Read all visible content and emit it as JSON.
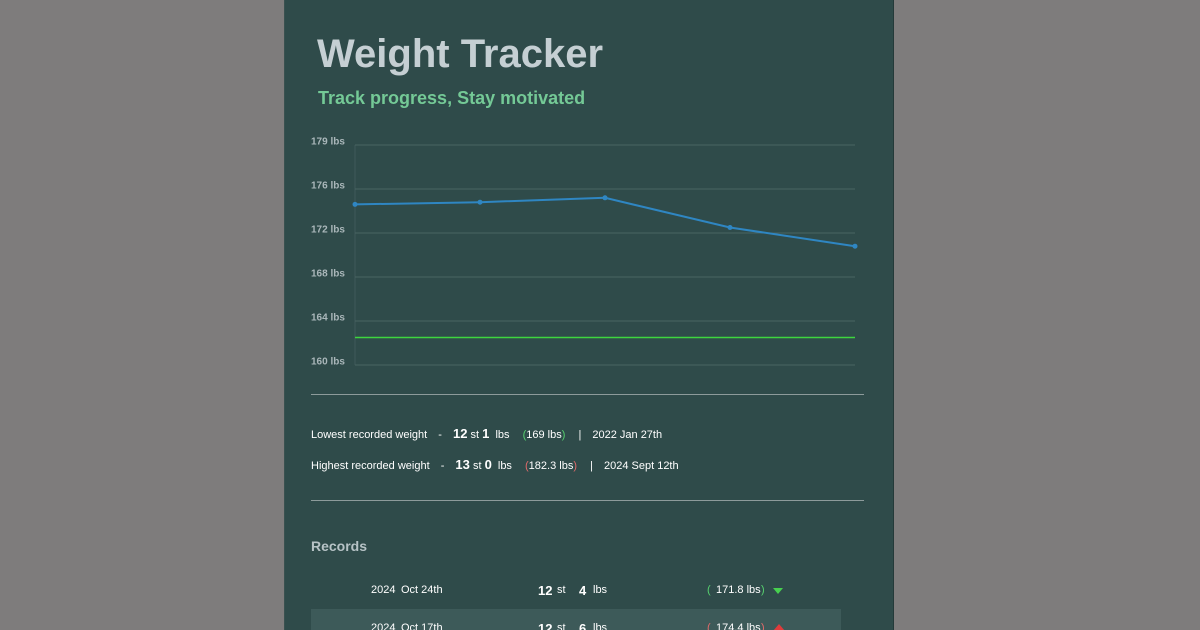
{
  "app": {
    "title": "Weight Tracker",
    "subtitle": "Track progress, Stay motivated"
  },
  "chart_data": {
    "type": "line",
    "y_unit_suffix": " lbs",
    "ylim": [
      160,
      180
    ],
    "yticks": [
      {
        "value": 180,
        "label": "179 lbs"
      },
      {
        "value": 176,
        "label": "176 lbs"
      },
      {
        "value": 172,
        "label": "172 lbs"
      },
      {
        "value": 168,
        "label": "168 lbs"
      },
      {
        "value": 164,
        "label": "164 lbs"
      },
      {
        "value": 160,
        "label": "160 lbs"
      }
    ],
    "series": [
      {
        "values": [
          174.6,
          174.8,
          175.2,
          172.5,
          170.8
        ],
        "color": "#2f86c2"
      }
    ],
    "target_line": {
      "value": 162.5,
      "color": "#3ed53e"
    },
    "grid": true,
    "xlabel": "",
    "ylabel": ""
  },
  "stats": {
    "lowest": {
      "label": "Lowest recorded weight",
      "dash": "-",
      "stone": "12",
      "st_unit": "st",
      "pounds": "1",
      "lbs_unit": "lbs",
      "open": "(",
      "total": "169 lbs",
      "close": ")",
      "sep": "|",
      "date": "2022 Jan 27th"
    },
    "highest": {
      "label": "Highest recorded weight",
      "dash": "-",
      "stone": "13",
      "st_unit": "st",
      "pounds": "0",
      "lbs_unit": "lbs",
      "open": "(",
      "total": "182.3 lbs",
      "close": ")",
      "sep": "|",
      "date": "2024 Sept 12th"
    }
  },
  "records": {
    "title": "Records",
    "rows": [
      {
        "year": "2024",
        "date": "Oct 24th",
        "stone": "12",
        "st_unit": "st",
        "pounds": "4",
        "lbs_unit": "lbs",
        "open": "(",
        "total": "171.8 lbs",
        "close": ")",
        "trend": "down"
      },
      {
        "year": "2024",
        "date": "Oct 17th",
        "stone": "12",
        "st_unit": "st",
        "pounds": "6",
        "lbs_unit": "lbs",
        "open": "(",
        "total": "174.4 lbs",
        "close": ")",
        "trend": "up"
      }
    ]
  },
  "colors": {
    "background": "#7e7c7c",
    "panel": "#2f4b4a",
    "title": "#c5cfd3",
    "accent_green": "#74c996",
    "up": "#e03b3b",
    "down": "#47d04f"
  }
}
